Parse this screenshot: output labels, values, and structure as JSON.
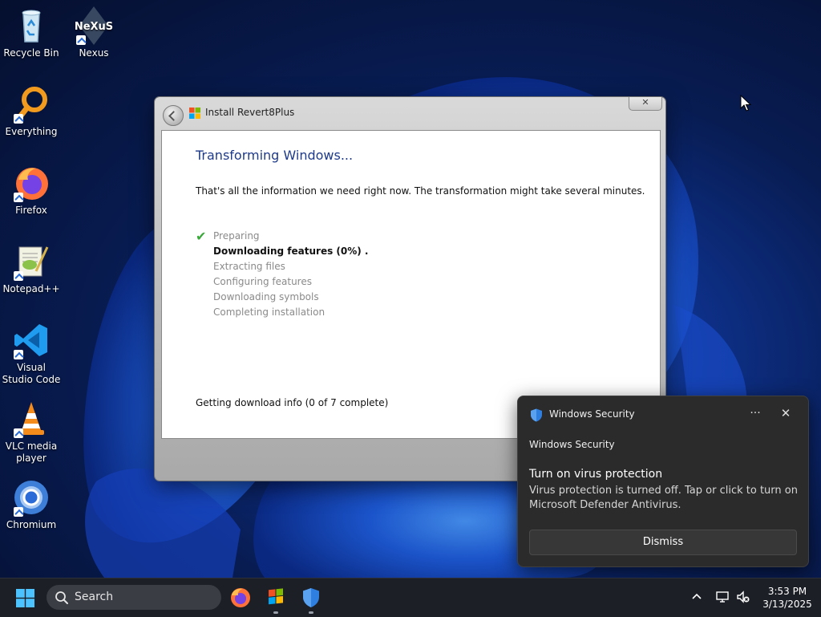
{
  "desktop": {
    "icons": [
      {
        "label": "Recycle Bin"
      },
      {
        "label": "Nexus"
      },
      {
        "label": "Everything"
      },
      {
        "label": "Firefox"
      },
      {
        "label": "Notepad++"
      },
      {
        "label": "Visual Studio Code"
      },
      {
        "label": "VLC media player"
      },
      {
        "label": "Chromium"
      }
    ],
    "nexus_logo_text": "NeXuS"
  },
  "installer": {
    "title": "Install Revert8Plus",
    "heading": "Transforming Windows...",
    "info": "That's all the information we need right now. The transformation might take several minutes.",
    "steps": [
      {
        "label": "Preparing",
        "state": "done"
      },
      {
        "label": "Downloading features (0%) .",
        "state": "active"
      },
      {
        "label": "Extracting files",
        "state": "pending"
      },
      {
        "label": "Configuring features",
        "state": "pending"
      },
      {
        "label": "Downloading symbols",
        "state": "pending"
      },
      {
        "label": "Completing installation",
        "state": "pending"
      }
    ],
    "status": "Getting download info (0 of 7 complete)",
    "close_glyph": "✕"
  },
  "toast": {
    "app_name": "Windows Security",
    "more_glyph": "···",
    "close_glyph": "✕",
    "source": "Windows Security",
    "heading": "Turn on virus protection",
    "body": "Virus protection is turned off. Tap or click to turn on Microsoft Defender Antivirus.",
    "dismiss_label": "Dismiss"
  },
  "taskbar": {
    "search_placeholder": "Search",
    "apps": [
      "firefox-icon",
      "revert8plus-icon",
      "windows-security-icon"
    ],
    "clock_time": "3:53 PM",
    "clock_date": "3/13/2025"
  },
  "colors": {
    "accent": "#1e3a8a",
    "check": "#3aa83a",
    "toast_bg": "#2b2b2b",
    "taskbar_bg": "#1c1f26"
  }
}
